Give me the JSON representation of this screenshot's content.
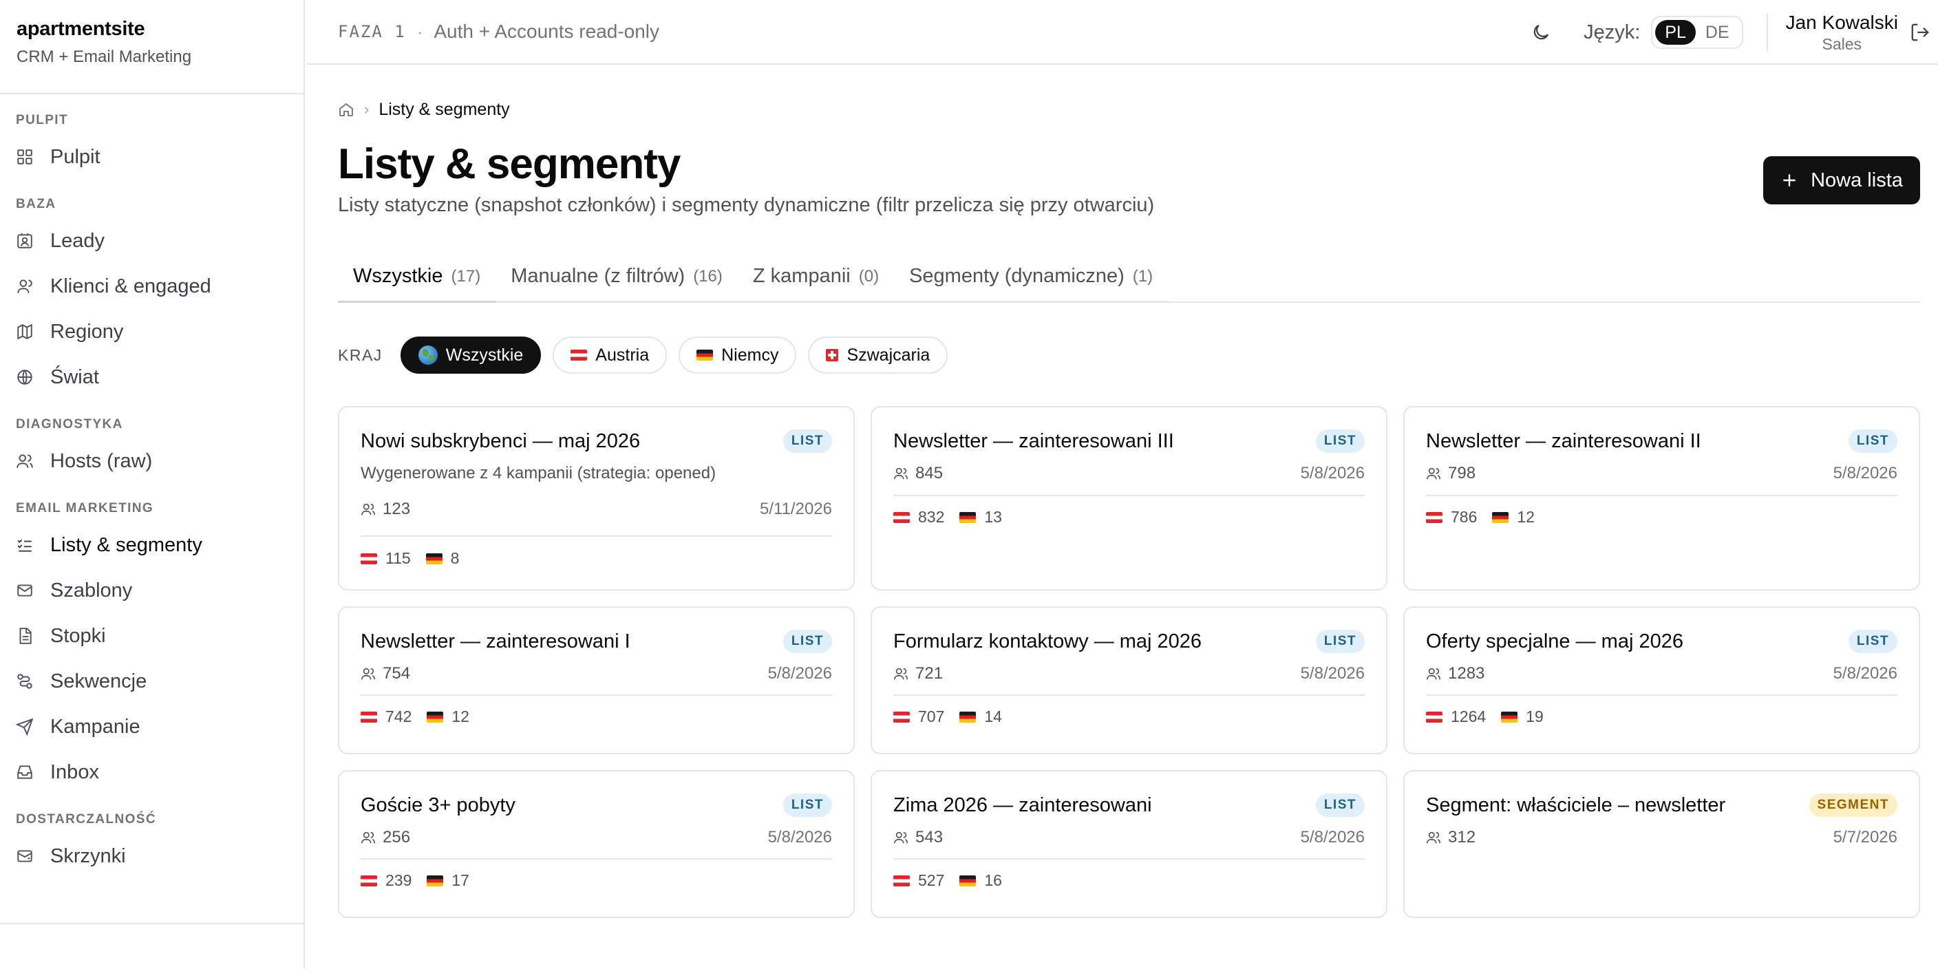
{
  "app": {
    "name": "apartmentsite",
    "subtitle": "CRM + Email Marketing"
  },
  "nav": {
    "groups": [
      {
        "heading": "PULPIT",
        "items": [
          {
            "label": "Pulpit",
            "icon": "grid-icon"
          }
        ]
      },
      {
        "heading": "BAZA",
        "items": [
          {
            "label": "Leady",
            "icon": "contact-icon"
          },
          {
            "label": "Klienci & engaged",
            "icon": "user-icon"
          },
          {
            "label": "Regiony",
            "icon": "map-icon"
          },
          {
            "label": "Świat",
            "icon": "globe-icon"
          }
        ]
      },
      {
        "heading": "DIAGNOSTYKA",
        "items": [
          {
            "label": "Hosts (raw)",
            "icon": "users-icon"
          }
        ]
      },
      {
        "heading": "EMAIL MARKETING",
        "items": [
          {
            "label": "Listy & segmenty",
            "icon": "list-check-icon"
          },
          {
            "label": "Szablony",
            "icon": "mail-icon"
          },
          {
            "label": "Stopki",
            "icon": "document-icon"
          },
          {
            "label": "Sekwencje",
            "icon": "route-icon"
          },
          {
            "label": "Kampanie",
            "icon": "send-icon"
          },
          {
            "label": "Inbox",
            "icon": "inbox-icon"
          }
        ]
      },
      {
        "heading": "DOSTARCZALNOŚĆ",
        "items": [
          {
            "label": "Skrzynki",
            "icon": "mailbox-icon"
          }
        ]
      }
    ]
  },
  "header": {
    "phase_code": "FAZA 1",
    "phase_sep": "·",
    "phase_title": "Auth + Accounts read-only",
    "language_label": "Język:",
    "languages": [
      "PL",
      "DE"
    ],
    "active_language": "PL",
    "user_name": "Jan Kowalski",
    "user_role": "Sales"
  },
  "page": {
    "breadcrumb_current": "Listy & segmenty",
    "title": "Listy & segmenty",
    "subtitle": "Listy statyczne (snapshot członków) i segmenty dynamiczne (filtr przelicza się przy otwarciu)",
    "new_button": "Nowa lista"
  },
  "tabs": [
    {
      "label": "Wszystkie",
      "count": "(17)"
    },
    {
      "label": "Manualne (z filtrów)",
      "count": "(16)"
    },
    {
      "label": "Z kampanii",
      "count": "(0)"
    },
    {
      "label": "Segmenty (dynamiczne)",
      "count": "(1)"
    }
  ],
  "filters": {
    "label": "KRAJ",
    "chips": [
      {
        "label": "Wszystkie",
        "flag": "globe"
      },
      {
        "label": "Austria",
        "flag": "at"
      },
      {
        "label": "Niemcy",
        "flag": "de"
      },
      {
        "label": "Szwajcaria",
        "flag": "ch"
      }
    ]
  },
  "cards": [
    {
      "title": "Nowi subskrybenci — maj 2026",
      "badge": "LIST",
      "desc": "Wygenerowane z 4 kampanii (strategia: opened)",
      "members": "123",
      "date": "5/11/2026",
      "at": "115",
      "de": "8"
    },
    {
      "title": "Newsletter — zainteresowani III",
      "badge": "LIST",
      "members": "845",
      "date": "5/8/2026",
      "at": "832",
      "de": "13"
    },
    {
      "title": "Newsletter — zainteresowani II",
      "badge": "LIST",
      "members": "798",
      "date": "5/8/2026",
      "at": "786",
      "de": "12"
    },
    {
      "title": "Newsletter — zainteresowani I",
      "badge": "LIST",
      "members": "754",
      "date": "5/8/2026",
      "at": "742",
      "de": "12"
    },
    {
      "title": "Formularz kontaktowy — maj 2026",
      "badge": "LIST",
      "members": "721",
      "date": "5/8/2026",
      "at": "707",
      "de": "14"
    },
    {
      "title": "Oferty specjalne — maj 2026",
      "badge": "LIST",
      "members": "1283",
      "date": "5/8/2026",
      "at": "1264",
      "de": "19"
    },
    {
      "title": "Goście 3+ pobyty",
      "badge": "LIST",
      "members": "256",
      "date": "5/8/2026",
      "at": "239",
      "de": "17"
    },
    {
      "title": "Zima 2026 — zainteresowani",
      "badge": "LIST",
      "members": "543",
      "date": "5/8/2026",
      "at": "527",
      "de": "16"
    },
    {
      "title": "Segment: właściciele – newsletter",
      "badge": "SEGMENT",
      "members": "312",
      "date": "5/7/2026"
    }
  ]
}
